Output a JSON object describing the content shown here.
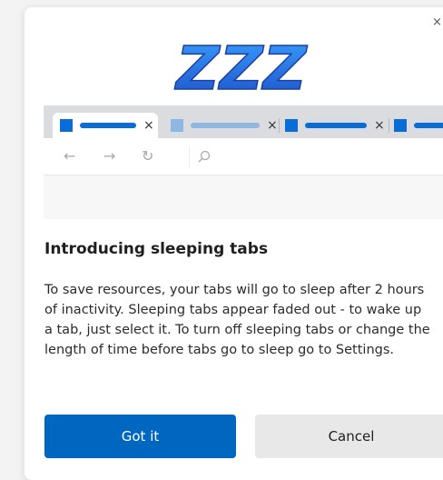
{
  "dialog": {
    "close_glyph": "×",
    "title": "Introducing sleeping tabs",
    "body": "To save resources, your tabs will go to sleep after 2 hours of inactivity. Sleeping tabs appear faded out - to wake up a tab, just select it. To turn off sleeping tabs or change the length of time before tabs go to sleep go to Settings.",
    "buttons": {
      "primary_label": "Got it",
      "secondary_label": "Cancel"
    }
  },
  "illustration": {
    "sleep_letters": "ZZZ",
    "tab_close_glyph": "×",
    "nav_icons": [
      "back-arrow-icon",
      "forward-arrow-icon",
      "refresh-icon",
      "search-icon"
    ]
  },
  "colors": {
    "accent": "#0067c0",
    "active_tab_blue": "#0a6cd6",
    "faded_tab_blue": "#8fb7e4"
  }
}
